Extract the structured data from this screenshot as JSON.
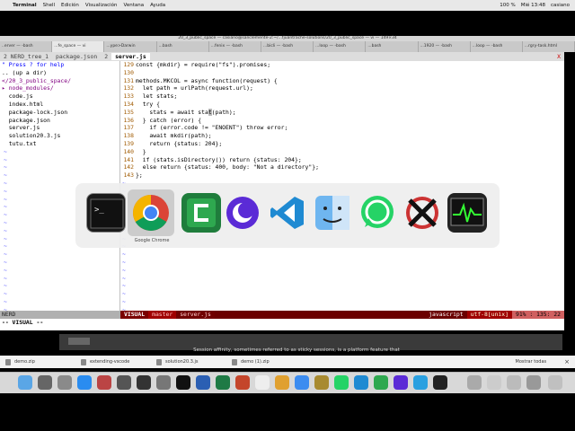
{
  "menubar": {
    "app": "Terminal",
    "items": [
      "Shell",
      "Edición",
      "Visualización",
      "Ventana",
      "Ayuda"
    ],
    "battery": "100 %",
    "clock": "Mié 13:48",
    "user": "casiano"
  },
  "window": {
    "title": "20_3_public_space — casiano@sanclemente-2:~/...fjuantrache-solutions/20_3_public_space — vi — 149×34",
    "tabs": [
      "..erver — -bash",
      "...fe_space — vi",
      "...ype>Darwin",
      "...bash",
      "...fenix — -bash",
      "...bicli — -bash",
      "...loop — -bash",
      "...bash",
      "...1920 — -bash",
      "...loop — -bash",
      "...rgry-task.html"
    ]
  },
  "vim": {
    "tabs": [
      "2 NERD_tree_1",
      "package.json",
      "2",
      "server.js"
    ],
    "close": "X",
    "tree": {
      "help": "\" Press ? for help",
      "up": ".. (up a dir)",
      "root": "</20_3_public_space/",
      "entries": [
        "▸ node_modules/",
        "  code.js",
        "  index.html",
        "  package-lock.json",
        "  package.json",
        "  server.js",
        "  solution20.3.js",
        "  tutu.txt"
      ]
    },
    "code": [
      {
        "n": "129",
        "t": "const {mkdir} = require(\"fs\").promises;"
      },
      {
        "n": "130",
        "t": ""
      },
      {
        "n": "131",
        "t": "methods.MKCOL = async function(request) {"
      },
      {
        "n": "132",
        "t": "  let path = urlPath(request.url);"
      },
      {
        "n": "133",
        "t": "  let stats;"
      },
      {
        "n": "134",
        "t": "  try {"
      },
      {
        "n": "135",
        "t": "    stats = await stat(path);"
      },
      {
        "n": "136",
        "t": "  } catch (error) {"
      },
      {
        "n": "137",
        "t": "    if (error.code != \"ENOENT\") throw error;"
      },
      {
        "n": "138",
        "t": "    await mkdir(path);"
      },
      {
        "n": "139",
        "t": "    return {status: 204};"
      },
      {
        "n": "140",
        "t": "  }"
      },
      {
        "n": "141",
        "t": "  if (stats.isDirectory()) return {status: 204};"
      },
      {
        "n": "142",
        "t": "  else return {status: 400, body: \"Not a directory\"};"
      },
      {
        "n": "143",
        "t": "};"
      }
    ],
    "status": {
      "left": "NERD",
      "mode": "VISUAL",
      "branch": "master",
      "file": "server.js",
      "filetype": "javascript",
      "encoding": "utf-8[unix]",
      "position": "91% : 135: 22"
    },
    "cmdline": "-- VISUAL --"
  },
  "switcher": {
    "apps": [
      {
        "name": "Terminal",
        "icon": "terminal-icon"
      },
      {
        "name": "Google Chrome",
        "icon": "chrome-icon"
      },
      {
        "name": "Camtasia",
        "icon": "camtasia-icon"
      },
      {
        "name": "Nocturne",
        "icon": "moon-icon"
      },
      {
        "name": "Visual Studio Code",
        "icon": "vscode-icon"
      },
      {
        "name": "Finder",
        "icon": "finder-icon"
      },
      {
        "name": "WhatsApp",
        "icon": "whatsapp-icon"
      },
      {
        "name": "X11",
        "icon": "x11-icon"
      },
      {
        "name": "Activity Monitor",
        "icon": "activity-monitor-icon"
      }
    ],
    "selected_label": "Google Chrome"
  },
  "browser": {
    "caption": "Session affinity, sometimes referred to as sticky sessions, is a platform feature that",
    "downloads": [
      "demo.zip",
      "extending-vscode",
      "solution20.3.js",
      "demo (1).zip"
    ],
    "show_all": "Mostrar todas"
  }
}
